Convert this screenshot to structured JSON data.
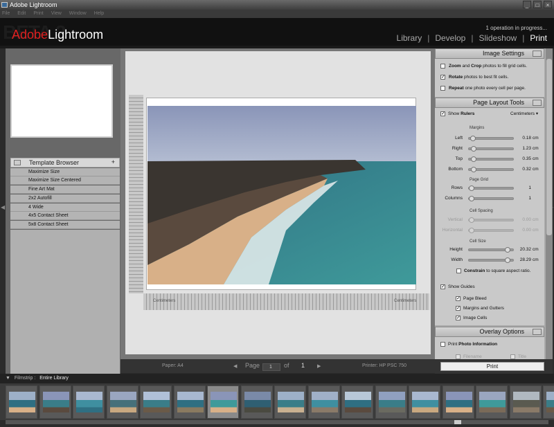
{
  "window": {
    "title": "Adobe Lightroom",
    "controls": [
      "_",
      "□",
      "×"
    ]
  },
  "menu": [
    "File",
    "Edit",
    "Print",
    "View",
    "Window",
    "Help"
  ],
  "header": {
    "beta": "BETA 2",
    "logo_adobe": "Adobe",
    "logo_lightroom": "Lightroom",
    "status": "1 operation in progress...",
    "modules": [
      "Library",
      "Develop",
      "Slideshow",
      "Print"
    ],
    "separator": "|"
  },
  "left": {
    "template_browser": {
      "title": "Template Browser",
      "add": "+",
      "items": [
        "Maximize Size",
        "Maximize Size Centered",
        "Fine Art Mat",
        "2x2 Autofill",
        "4 Wide",
        "4x5 Contact Sheet",
        "5x8 Contact Sheet"
      ]
    }
  },
  "ruler": {
    "h_left": "Centimeters",
    "h_right": "Centimeters"
  },
  "bottom": {
    "paper": "Paper: A4",
    "page_label": "Page",
    "page_value": "1",
    "of": "of",
    "total": "1",
    "printer": "Printer: HP PSC 750"
  },
  "image_settings": {
    "title": "Image Settings",
    "opt1": {
      "b1": "Zoom",
      "m1": " and ",
      "b2": "Crop",
      "rest": " photos to fill grid cells.",
      "checked": false
    },
    "opt2": {
      "b1": "Rotate",
      "rest": " photos to best fit cells.",
      "checked": true
    },
    "opt3": {
      "b1": "Repeat",
      "rest": " one photo every cell per page.",
      "checked": false
    }
  },
  "page_layout": {
    "title": "Page Layout Tools",
    "show": "Show ",
    "rulers": "Rulers",
    "units": "Centimeters ▾",
    "margins_label": "Margins",
    "grid_label": "Page Grid",
    "spacing_label": "Cell Spacing",
    "size_label": "Cell Size",
    "rows": [
      {
        "label": "Left",
        "value": "0.18",
        "unit": "cm",
        "fraction": 0.03
      },
      {
        "label": "Right",
        "value": "1.23",
        "unit": "cm",
        "fraction": 0.05
      },
      {
        "label": "Top",
        "value": "0.35",
        "unit": "cm",
        "fraction": 0.05
      },
      {
        "label": "Bottom",
        "value": "0.32",
        "unit": "cm",
        "fraction": 0.05
      },
      {
        "label": "Rows",
        "value": "1",
        "unit": "",
        "fraction": 0.0
      },
      {
        "label": "Columns",
        "value": "1",
        "unit": "",
        "fraction": 0.0
      },
      {
        "label": "Vertical",
        "value": "0.00",
        "unit": "cm",
        "fraction": 0.0,
        "dim": true
      },
      {
        "label": "Horizontal",
        "value": "0.00",
        "unit": "cm",
        "fraction": 0.0,
        "dim": true
      },
      {
        "label": "Height",
        "value": "20.32",
        "unit": "cm",
        "fraction": 0.9
      },
      {
        "label": "Width",
        "value": "28.29",
        "unit": "cm",
        "fraction": 0.9
      }
    ],
    "constrain": {
      "b": "Constrain",
      "rest": " to square aspect ratio."
    },
    "show_guides": "Show Guides",
    "guides": [
      "Page Bleed",
      "Margins and Gutters",
      "Image Cells"
    ]
  },
  "overlay": {
    "title": "Overlay Options",
    "print_info": "Print ",
    "photo_info": "Photo Information",
    "filename": "Filename",
    "title_opt": "Title"
  },
  "print_button": "Print",
  "filmstrip": {
    "label": "Filmstrip :",
    "source": "Entire Library",
    "arrow": "▼"
  },
  "icons": {
    "menu": "menu-icon",
    "arrowL": "◀",
    "arrowR": "▶",
    "prev": "◀",
    "next": "▶"
  }
}
